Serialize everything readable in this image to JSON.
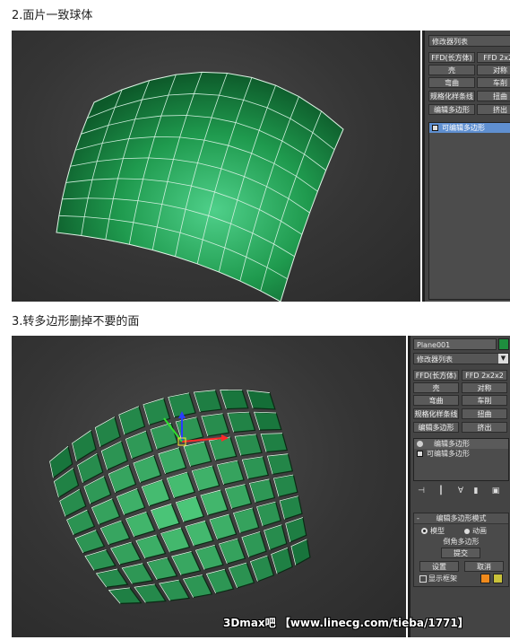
{
  "captions": {
    "step2": "2.面片一致球体",
    "step3": "3.转多边形删掉不要的面"
  },
  "shot1_panel": {
    "modifier_list": "修改器列表",
    "buttons": [
      "FFD(长方体)",
      "FFD 2x2x",
      "壳",
      "对称",
      "弯曲",
      "车削",
      "规格化样条线",
      "扭曲",
      "编辑多边形",
      "挤出"
    ],
    "stack_items": [
      "可编辑多边形"
    ]
  },
  "shot2_panel": {
    "object_name": "Plane001",
    "object_color": "#1e8e3e",
    "modifier_list": "修改器列表",
    "buttons": [
      "FFD(长方体)",
      "FFD 2x2x2",
      "壳",
      "对称",
      "弯曲",
      "车削",
      "规格化样条线",
      "扭曲",
      "编辑多边形",
      "挤出"
    ],
    "stack_items": [
      "编辑多边形",
      "可编辑多边形"
    ],
    "rollout": {
      "title": "编辑多边形模式",
      "model_label": "模型",
      "animate_label": "动画",
      "bevel_label": "倒角多边形",
      "commit_label": "提交",
      "settings_label": "设置",
      "cancel_label": "取消",
      "show_cage_label": "显示框架",
      "cage_colors": [
        "#f08a1c",
        "#c9c23a"
      ]
    }
  },
  "watermark": "3Dmax吧 【www.linecg.com/tieba/1771】"
}
